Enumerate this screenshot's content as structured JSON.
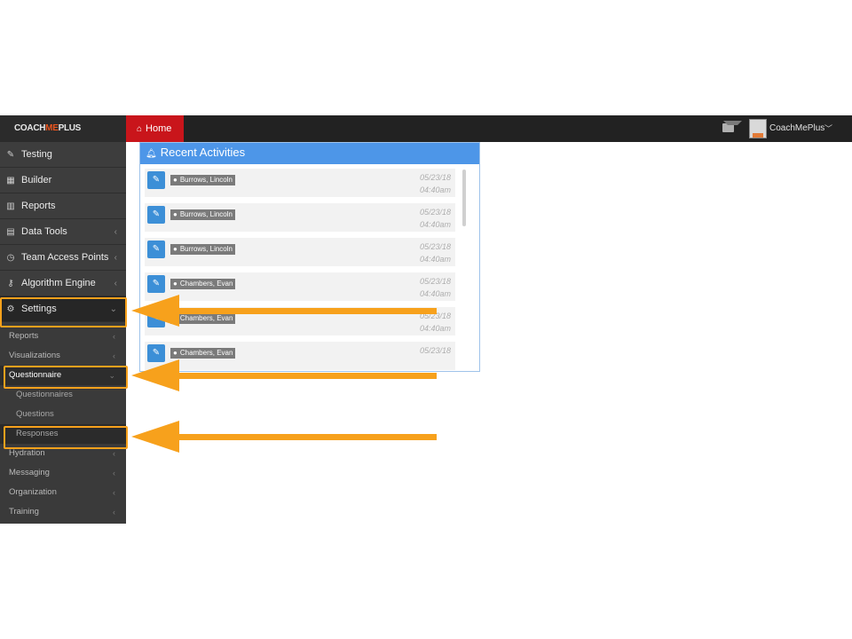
{
  "brand": {
    "prefix": "COACH",
    "me": "ME",
    "suffix": "PLUS"
  },
  "topbar": {
    "home_icon": "home-icon",
    "home_label": "Home",
    "user_name": "CoachMePlus",
    "user_caret": "﹀"
  },
  "sidebar": {
    "items": [
      {
        "label": "Testing",
        "icon": "edit-icon"
      },
      {
        "label": "Builder",
        "icon": "calendar-icon"
      },
      {
        "label": "Reports",
        "icon": "bar-chart-icon"
      },
      {
        "label": "Data Tools",
        "icon": "table-icon"
      },
      {
        "label": "Team Access Points",
        "icon": "clock-icon"
      },
      {
        "label": "Algorithm Engine",
        "icon": "key-icon"
      },
      {
        "label": "Settings",
        "icon": "cogs-icon"
      }
    ],
    "sub_items": [
      "Reports",
      "Visualizations",
      "Questionnaire"
    ],
    "subsub_items": [
      "Questionnaires",
      "Questions",
      "Responses"
    ],
    "more_items": [
      "Hydration",
      "Messaging",
      "Organization",
      "Training"
    ]
  },
  "panel": {
    "title": "Recent Activities",
    "activities": [
      {
        "user": "Burrows, Lincoln",
        "date": "05/23/18",
        "time": "04:40am"
      },
      {
        "user": "Burrows, Lincoln",
        "date": "05/23/18",
        "time": "04:40am"
      },
      {
        "user": "Burrows, Lincoln",
        "date": "05/23/18",
        "time": "04:40am"
      },
      {
        "user": "Chambers, Evan",
        "date": "05/23/18",
        "time": "04:40am"
      },
      {
        "user": "Chambers, Evan",
        "date": "05/23/18",
        "time": "04:40am"
      },
      {
        "user": "Chambers, Evan",
        "date": "05/23/18",
        "time": ""
      }
    ]
  },
  "colors": {
    "accent": "#f7a11c",
    "home_tab": "#c9151b",
    "panel_header": "#4d96e8",
    "brand_me": "#e8541e"
  }
}
